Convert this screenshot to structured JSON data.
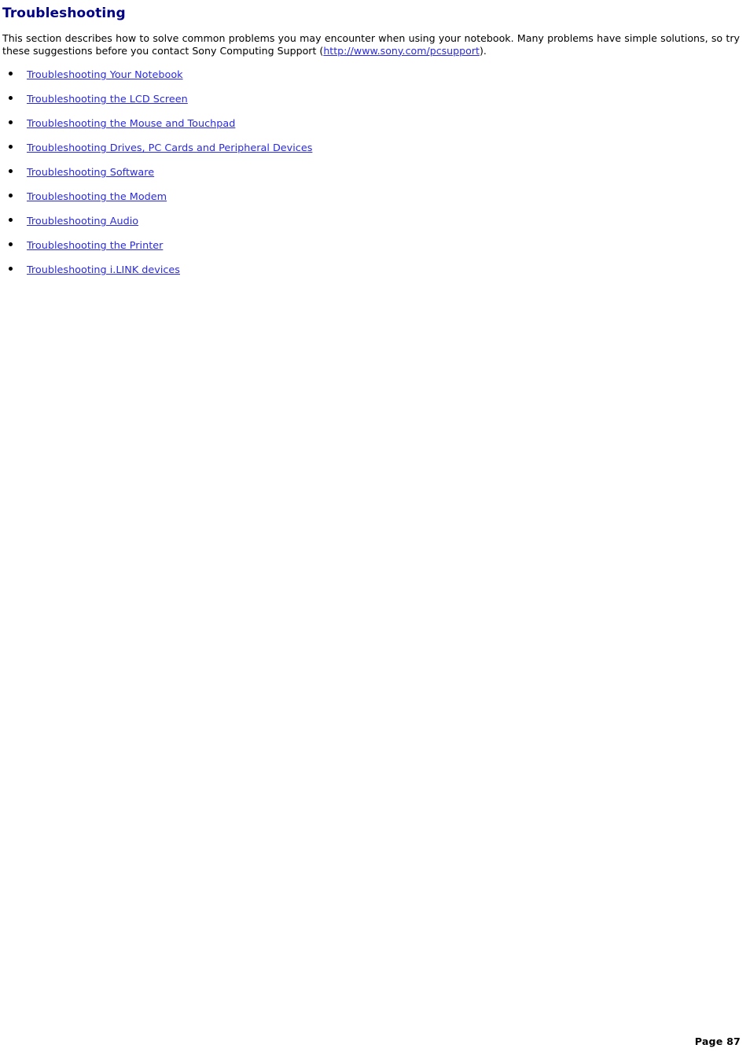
{
  "document": {
    "heading": "Troubleshooting",
    "intro": {
      "before_link": "This section describes how to solve common problems you may encounter when using your notebook. Many problems have simple solutions, so try these suggestions before you contact Sony Computing Support (",
      "link_text": "http://www.sony.com/pcsupport",
      "after_link": ")."
    },
    "toc": [
      {
        "label": "Troubleshooting Your Notebook"
      },
      {
        "label": "Troubleshooting the LCD Screen"
      },
      {
        "label": "Troubleshooting the Mouse and Touchpad"
      },
      {
        "label": "Troubleshooting Drives, PC Cards and Peripheral Devices"
      },
      {
        "label": "Troubleshooting Software"
      },
      {
        "label": "Troubleshooting the Modem"
      },
      {
        "label": "Troubleshooting Audio"
      },
      {
        "label": "Troubleshooting the Printer"
      },
      {
        "label": "Troubleshooting i.LINK devices"
      }
    ],
    "footer": {
      "page_label": "Page 87"
    },
    "colors": {
      "heading": "#000084",
      "link": "#2a2ae0",
      "body_text": "#000000",
      "background": "#ffffff"
    }
  }
}
